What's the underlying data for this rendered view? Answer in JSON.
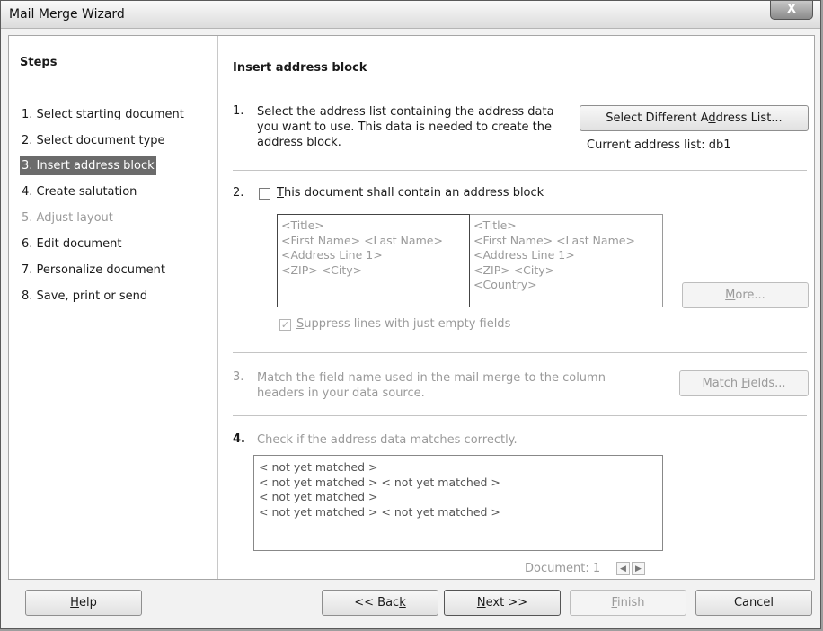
{
  "window": {
    "title": "Mail Merge Wizard",
    "close_glyph": "X"
  },
  "steps": {
    "heading": "Steps",
    "items": [
      {
        "label": "1. Select starting document",
        "state": "normal"
      },
      {
        "label": "2. Select document type",
        "state": "normal"
      },
      {
        "label": "3. Insert address block",
        "state": "active"
      },
      {
        "label": "4. Create salutation",
        "state": "normal"
      },
      {
        "label": "5. Adjust layout",
        "state": "disabled"
      },
      {
        "label": "6. Edit document",
        "state": "normal"
      },
      {
        "label": "7. Personalize document",
        "state": "normal"
      },
      {
        "label": "8. Save, print or send",
        "state": "normal"
      }
    ]
  },
  "page": {
    "heading": "Insert address block",
    "section1": {
      "number": "1.",
      "text_lines": [
        "Select the address list containing the address data",
        "you want to use. This data is needed to create the",
        "address block."
      ],
      "button": "Select Different Address List...",
      "current_list": "Current address list: db1"
    },
    "section2": {
      "number": "2.",
      "checkbox_label": "This document shall contain an address block",
      "checked": false,
      "preview_left": [
        "<Title>",
        "<First Name> <Last Name>",
        "<Address Line 1>",
        "<ZIP> <City>"
      ],
      "preview_right": [
        "<Title>",
        "<First Name> <Last Name>",
        "<Address Line 1>",
        "<ZIP> <City>",
        "<Country>"
      ],
      "more_button": "More...",
      "suppress_label": "Suppress lines with just empty fields",
      "suppress_checked": true
    },
    "section3": {
      "number": "3.",
      "text_lines": [
        "Match the field name used in the mail merge to the column",
        "headers in your data source."
      ],
      "button": "Match Fields..."
    },
    "section4": {
      "number": "4.",
      "text": "Check if the address data matches correctly.",
      "lines": [
        "< not yet matched >",
        "< not yet matched > < not yet matched >",
        "< not yet matched >",
        "< not yet matched > < not yet matched >"
      ],
      "document_label": "Document: 1",
      "prev_glyph": "◀",
      "next_glyph": "▶"
    }
  },
  "footer": {
    "help": "Help",
    "back": "<< Back",
    "next": "Next >>",
    "finish": "Finish",
    "cancel": "Cancel"
  }
}
